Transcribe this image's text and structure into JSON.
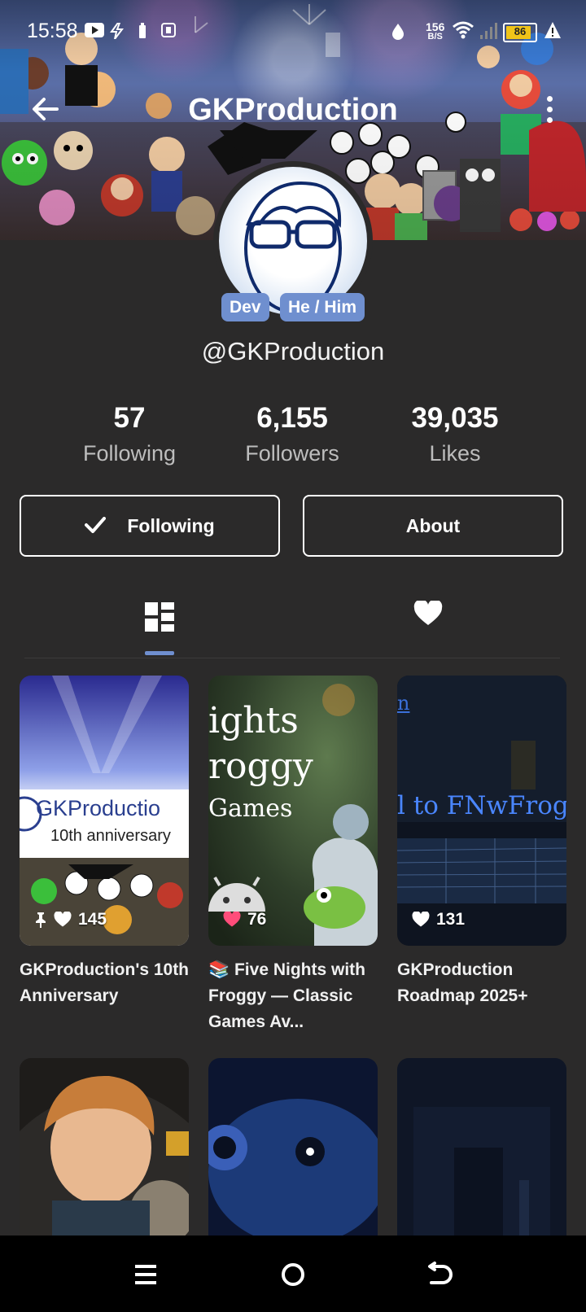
{
  "status_bar": {
    "time": "15:58",
    "speed_value": "156",
    "speed_unit": "B/S",
    "battery_pct": "86"
  },
  "header": {
    "title": "GKProduction",
    "back_icon": "arrow-left-icon",
    "more_icon": "more-vertical-icon"
  },
  "profile": {
    "tags": [
      "Dev",
      "He / Him"
    ],
    "handle": "@GKProduction",
    "stats": [
      {
        "value": "57",
        "label": "Following"
      },
      {
        "value": "6,155",
        "label": "Followers"
      },
      {
        "value": "39,035",
        "label": "Likes"
      }
    ],
    "following_button": "Following",
    "about_button": "About"
  },
  "tabs": {
    "posts_icon": "grid-layout-icon",
    "liked_icon": "heart-icon",
    "active": "posts"
  },
  "posts": [
    {
      "title": "GKProduction's 10th Anniversary",
      "likes": "145",
      "pinned": true,
      "overlay": [
        "GKProductio",
        "10th anniversary"
      ]
    },
    {
      "title": "📚 Five Nights with Froggy — Classic Games Av...",
      "likes": "76",
      "pinned": false,
      "overlay": [
        "ights",
        "roggy",
        "Games"
      ]
    },
    {
      "title": "GKProduction Roadmap 2025+",
      "likes": "131",
      "pinned": false,
      "overlay": [
        "n",
        "l to FNwFrog"
      ]
    }
  ],
  "colors": {
    "background": "#2b2a2a",
    "accent": "#6f8fcf",
    "heart_pink": "#ff4d7a",
    "battery": "#f0c419"
  }
}
